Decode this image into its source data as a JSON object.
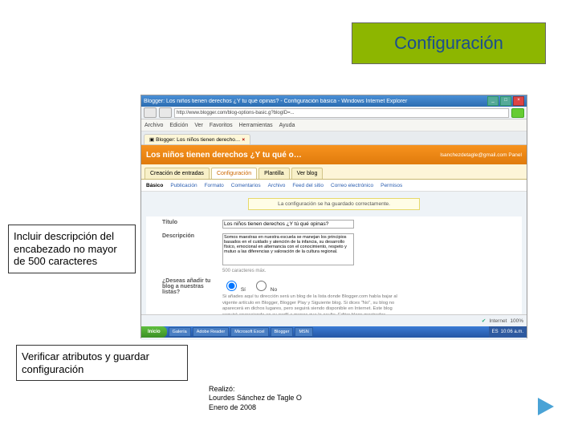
{
  "title": "Configuración",
  "callout1": "Incluir descripción del encabezado  no mayor de 500 caracteres",
  "callout2": "Verificar atributos y guardar configuración",
  "credit": {
    "l1": "Realizó:",
    "l2": "Lourdes Sánchez de Tagle O",
    "l3": "Enero de 2008"
  },
  "browser": {
    "window_title": "Blogger: Los niños tienen derechos ¿Y tu qué opinas? - Configuración básica - Windows Internet Explorer",
    "url": "http://www.blogger.com/blog-options-basic.g?blogID=...",
    "menu": [
      "Archivo",
      "Edición",
      "Ver",
      "Favoritos",
      "Herramientas",
      "Ayuda"
    ],
    "tab_label": "Blogger: Los niños tienen derecho…",
    "header_left": "Los niños tienen derechos ¿Y tu qué o…",
    "header_right": "lsanchezdetagle@gmail.com  Panel",
    "main_tabs": [
      "Creación de entradas",
      "Configuración",
      "Plantilla",
      "Ver blog"
    ],
    "sub_tabs": [
      "Básico",
      "Publicación",
      "Formato",
      "Comentarios",
      "Archivo",
      "Feed del sitio",
      "Correo electrónico",
      "Permisos"
    ],
    "notice": "La configuración se ha guardado correctamente.",
    "form": {
      "titulo_label": "Título",
      "titulo_value": "Los niños tienen derechos ¿Y tú qué opinas?",
      "desc_label": "Descripción",
      "desc_value": "Somos maestras en nuestra escuela se manejan los principios basados en el cuidado y atención de la infancia, su desarrollo físico, emocional en alternancia con el conocimiento, respeto y mutuo a las diferencias y valoración de la cultura regional.",
      "counter": "500 caracteres máx.",
      "listar_label": "¿Deseas añadir tu blog a nuestras listas?",
      "si": "Sí",
      "no": "No",
      "help_text": "Si añades aquí tu dirección será un blog de la lista donde Blogger.com había bajar al vigente artículo en Blogger, Blogger Play y Siguiente blog. Si dices \"No\", su blog no aparecerá en dichos lugares, pero seguirá siendo disponible en Internet. Este blog seguirá apareciendo en su perfil a menos que lo oculte. Editar blogs mostrados."
    },
    "status": {
      "internet": "Internet",
      "zoom": "100%"
    },
    "taskbar": {
      "start": "Inicio",
      "btns": [
        "Galería",
        "Adobe Reader",
        "Microsoft Excel",
        "Blogger",
        "MSN",
        "ES"
      ],
      "clock": "10:06 a.m."
    }
  }
}
